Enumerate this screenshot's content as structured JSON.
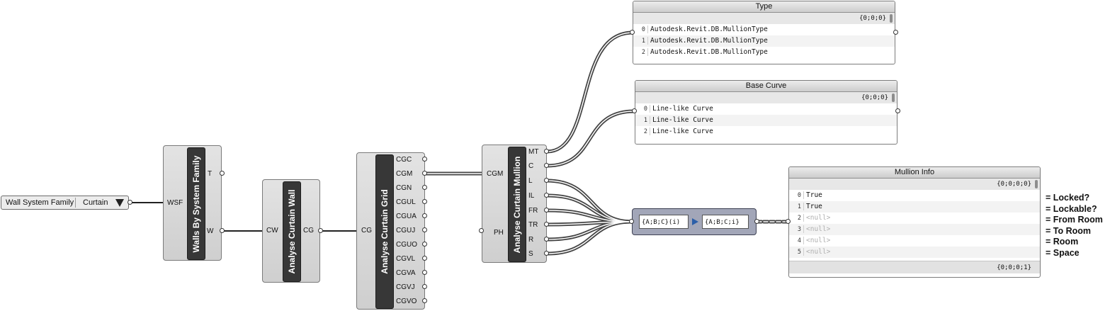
{
  "value_list": {
    "label": "Wall System Family",
    "value": "Curtain",
    "arrow_icon": "triangle-down-icon"
  },
  "walls_by_system_family": {
    "title": "Walls By System Family",
    "inputs": [
      "WSF"
    ],
    "outputs": [
      "T",
      "W"
    ]
  },
  "analyse_curtain_wall": {
    "title": "Analyse Curtain Wall",
    "inputs": [
      "CW"
    ],
    "outputs": [
      "CG"
    ]
  },
  "analyse_curtain_grid": {
    "title": "Analyse Curtain Grid",
    "inputs": [
      "CG"
    ],
    "outputs": [
      "CGC",
      "CGM",
      "CGN",
      "CGUL",
      "CGUA",
      "CGUJ",
      "CGUO",
      "CGVL",
      "CGVA",
      "CGVJ",
      "CGVO"
    ]
  },
  "analyse_curtain_mullion": {
    "title": "Analyse Curtain Mullion",
    "inputs": [
      "CGM",
      "PH"
    ],
    "outputs": [
      "MT",
      "C",
      "L",
      "IL",
      "FR",
      "TR",
      "R",
      "S"
    ]
  },
  "type_panel": {
    "title": "Type",
    "header": "{0;0;0}",
    "rows": [
      {
        "i": "0",
        "t": "Autodesk.Revit.DB.MullionType"
      },
      {
        "i": "1",
        "t": "Autodesk.Revit.DB.MullionType"
      },
      {
        "i": "2",
        "t": "Autodesk.Revit.DB.MullionType"
      }
    ]
  },
  "base_curve_panel": {
    "title": "Base Curve",
    "header": "{0;0;0}",
    "rows": [
      {
        "i": "0",
        "t": "Line-like Curve"
      },
      {
        "i": "1",
        "t": "Line-like Curve"
      },
      {
        "i": "2",
        "t": "Line-like Curve"
      }
    ]
  },
  "path_mapper": {
    "source": "{A;B;C}(i)",
    "target": "{A;B;C;i}"
  },
  "mullion_info_panel": {
    "title": "Mullion Info",
    "header": "{0;0;0;0}",
    "footer": "{0;0;0;1}",
    "rows": [
      {
        "i": "0",
        "t": "True"
      },
      {
        "i": "1",
        "t": "True"
      },
      {
        "i": "2",
        "t": "<null>"
      },
      {
        "i": "3",
        "t": "<null>"
      },
      {
        "i": "4",
        "t": "<null>"
      },
      {
        "i": "5",
        "t": "<null>"
      }
    ]
  },
  "annotations": [
    "= Locked?",
    "= Lockable?",
    "= From Room",
    "= To Room",
    "= Room",
    "= Space"
  ]
}
